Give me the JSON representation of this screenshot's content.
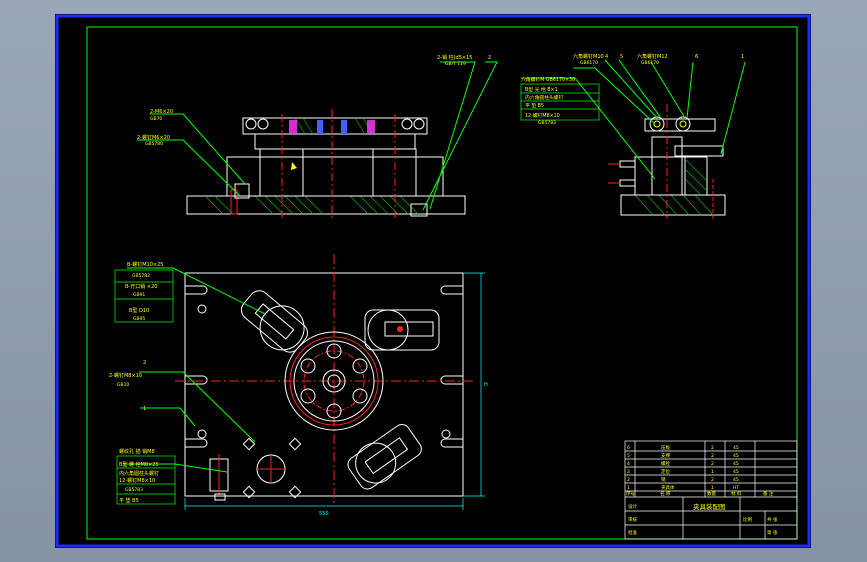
{
  "colors": {
    "background": "#000000",
    "border_outer": "#1f2bff",
    "border_inner": "#00ff00",
    "geometry": "#ffffff",
    "centerline": "#ff2020",
    "hatch": "#00c000",
    "leader": "#00ff00",
    "text": "#ffff00",
    "dimension": "#00ffff",
    "part_fill": "#ffffff"
  },
  "front_view": {
    "callouts": [
      {
        "text": "2-销 柱(d5×15"
      },
      {
        "text": "GB/T 119"
      },
      {
        "text": "2"
      }
    ],
    "left_notes": [
      {
        "text": "2-M6×20"
      },
      {
        "text": "GB70"
      },
      {
        "text": "2-螺钉M6×20"
      },
      {
        "text": "GB5780"
      }
    ]
  },
  "side_view": {
    "callouts": [
      {
        "text": "六角螺钉M10"
      },
      {
        "text": "GB6170"
      },
      {
        "text": "4"
      },
      {
        "text": "5"
      },
      {
        "text": "六角螺钉M12"
      },
      {
        "text": "GB6170"
      },
      {
        "text": "6"
      },
      {
        "text": "1"
      }
    ],
    "notes": [
      {
        "text": "六角螺钉M   GB6170×30"
      },
      {
        "text": "B型 光 栓 B×1"
      },
      {
        "text": "内六角圆柱头螺钉"
      },
      {
        "text": "平 垫 B5"
      },
      {
        "text": "12-螺钉M8×10"
      },
      {
        "text": "GB5783"
      }
    ]
  },
  "plan_view": {
    "notes_left": [
      {
        "text": "B-螺钉M10×25"
      },
      {
        "text": "GB5782"
      },
      {
        "text": "B-开口销 ×20"
      },
      {
        "text": "GB91"
      },
      {
        "text": "B型 D10"
      },
      {
        "text": "GB95"
      },
      {
        "text": "2"
      },
      {
        "text": "2-螺钉M8×10"
      },
      {
        "text": "GB10"
      },
      {
        "text": "1"
      }
    ],
    "notes_bottom": [
      {
        "text": "螺纹孔 插 销M8"
      },
      {
        "text": "B型 螺 栓M8×25"
      },
      {
        "text": "内六角圆柱头螺钉"
      },
      {
        "text": "12-螺钉M8×10"
      },
      {
        "text": "GB5783"
      },
      {
        "text": "平 垫 B5"
      }
    ],
    "dim_width": "550",
    "dim_height": "H"
  },
  "title_block": {
    "title": "夹具装配图",
    "rows": [
      {
        "no": "6",
        "name": "压板",
        "qty": "2",
        "mat": "45"
      },
      {
        "no": "5",
        "name": "支撑",
        "qty": "2",
        "mat": "45"
      },
      {
        "no": "4",
        "name": "螺栓",
        "qty": "2",
        "mat": "45"
      },
      {
        "no": "3",
        "name": "定位",
        "qty": "1",
        "mat": "45"
      },
      {
        "no": "2",
        "name": "销",
        "qty": "2",
        "mat": "45"
      },
      {
        "no": "1",
        "name": "夹具体",
        "qty": "1",
        "mat": "HT"
      }
    ],
    "header": {
      "no": "序号",
      "name": "名 称",
      "qty": "数量",
      "mat": "材 料",
      "remark": "备 注"
    },
    "labels": [
      "设计",
      "审核",
      "批准",
      "比例",
      "共 张",
      "第 张"
    ]
  }
}
